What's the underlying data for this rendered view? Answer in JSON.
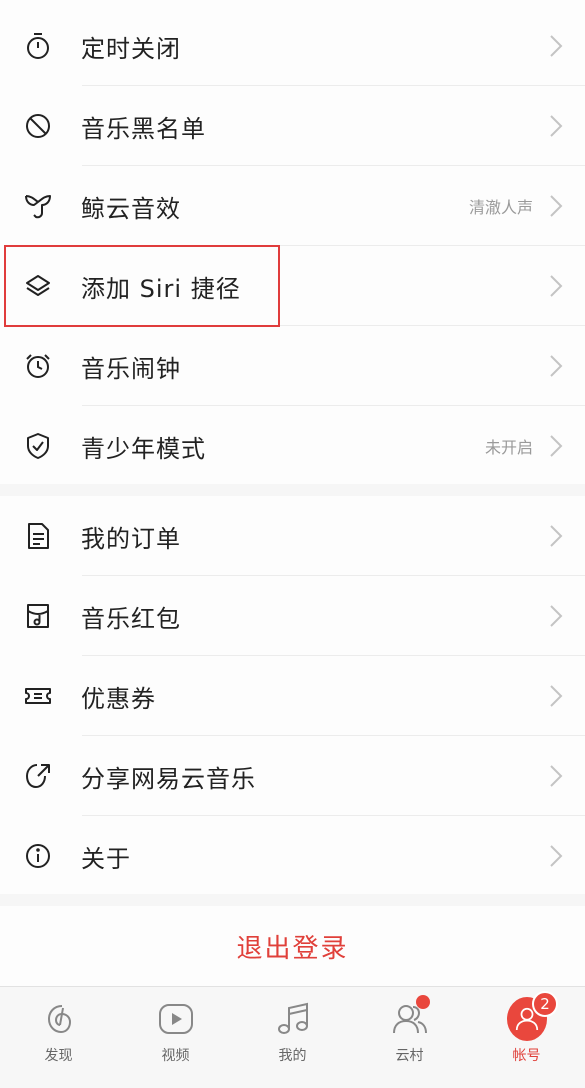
{
  "settings_group1": [
    {
      "label": "定时关闭",
      "value": "",
      "icon": "timer-icon"
    },
    {
      "label": "音乐黑名单",
      "value": "",
      "icon": "block-icon"
    },
    {
      "label": "鲸云音效",
      "value": "清澈人声",
      "icon": "whale-icon"
    },
    {
      "label": "添加 Siri 捷径",
      "value": "",
      "icon": "layers-icon"
    },
    {
      "label": "音乐闹钟",
      "value": "",
      "icon": "alarm-icon"
    },
    {
      "label": "青少年模式",
      "value": "未开启",
      "icon": "shield-icon"
    }
  ],
  "settings_group2": [
    {
      "label": "我的订单",
      "value": "",
      "icon": "order-icon"
    },
    {
      "label": "音乐红包",
      "value": "",
      "icon": "music-wallet-icon"
    },
    {
      "label": "优惠券",
      "value": "",
      "icon": "coupon-icon"
    },
    {
      "label": "分享网易云音乐",
      "value": "",
      "icon": "share-icon"
    },
    {
      "label": "关于",
      "value": "",
      "icon": "info-icon"
    }
  ],
  "logout_label": "退出登录",
  "tabbar": {
    "tabs": [
      {
        "label": "发现",
        "icon": "discover-icon",
        "active": false
      },
      {
        "label": "视频",
        "icon": "video-icon",
        "active": false
      },
      {
        "label": "我的",
        "icon": "music-note-icon",
        "active": false
      },
      {
        "label": "云村",
        "icon": "community-icon",
        "active": false,
        "dot": true
      },
      {
        "label": "帐号",
        "icon": "account-icon",
        "active": true,
        "badge": "2"
      }
    ]
  },
  "colors": {
    "accent": "#e9473d",
    "highlight_border": "#e03c3c"
  }
}
